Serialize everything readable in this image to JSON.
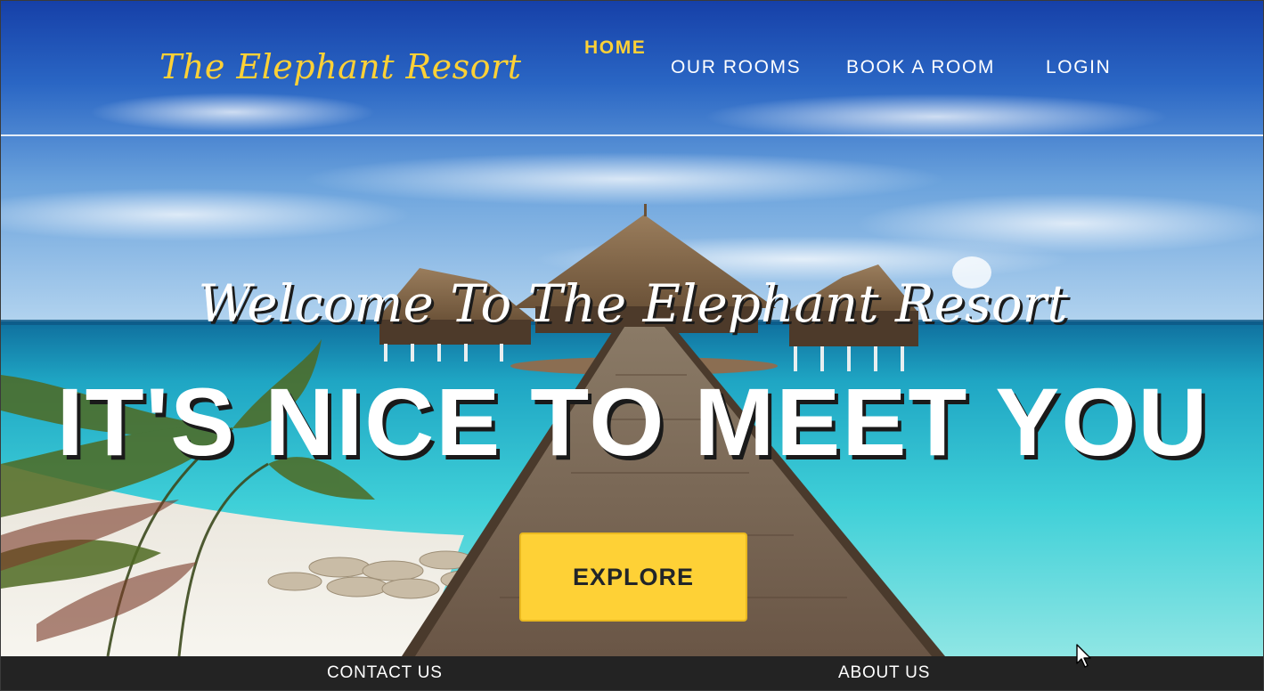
{
  "brand": {
    "name": "The Elephant Resort"
  },
  "nav": {
    "items": [
      {
        "label": "HOME",
        "active": true
      },
      {
        "label": "OUR ROOMS",
        "active": false
      },
      {
        "label": "BOOK A ROOM",
        "active": false
      },
      {
        "label": "LOGIN",
        "active": false
      }
    ]
  },
  "hero": {
    "subheading": "Welcome To The Elephant Resort",
    "heading": "IT'S NICE TO MEET YOU",
    "cta_label": "EXPLORE"
  },
  "footer": {
    "contact_label": "CONTACT US",
    "about_label": "ABOUT US"
  },
  "colors": {
    "accent": "#fed136",
    "text": "#ffffff",
    "footer_bg": "#232323",
    "button_text": "#212529"
  },
  "icons": {
    "cursor": "mouse-pointer-icon"
  }
}
